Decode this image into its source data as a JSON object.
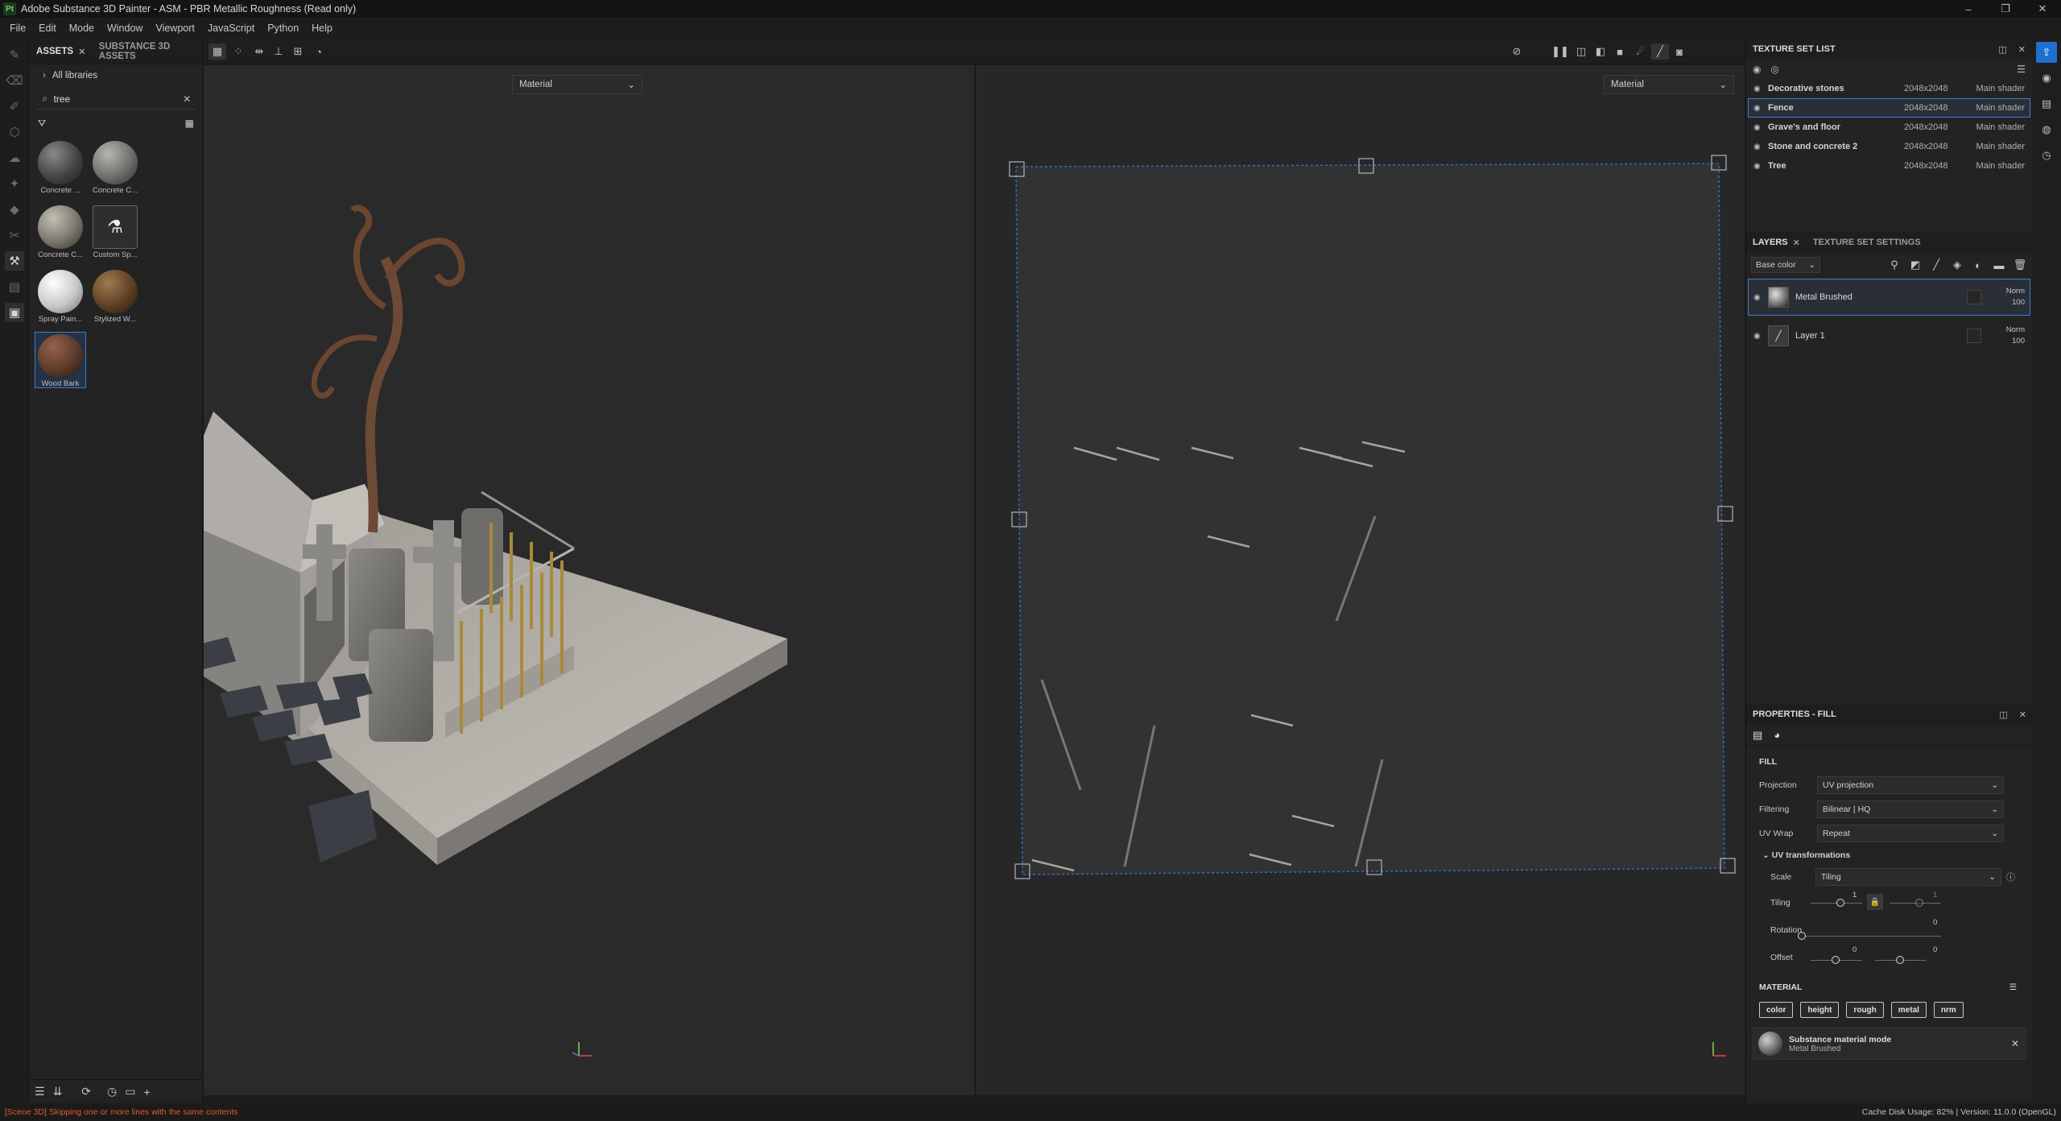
{
  "app": {
    "logo_text": "Pt",
    "title": "Adobe Substance 3D Painter - ASM - PBR Metallic Roughness (Read only)",
    "win_controls": [
      "–",
      "❐",
      "✕"
    ]
  },
  "menu": [
    "File",
    "Edit",
    "Mode",
    "Window",
    "Viewport",
    "JavaScript",
    "Python",
    "Help"
  ],
  "assets": {
    "tabs": [
      "ASSETS",
      "SUBSTANCE 3D ASSETS"
    ],
    "library": "All libraries",
    "search_value": "tree",
    "items": [
      {
        "label": "Concrete ...",
        "color": "#5c5c5c"
      },
      {
        "label": "Concrete C...",
        "color": "#8a8a88"
      },
      {
        "label": "Concrete C...",
        "color": "#9a9488"
      },
      {
        "label": "Custom Sp...",
        "color": "#3a3a3a"
      },
      {
        "label": "Spray Pain...",
        "color": "#d9d9d9"
      },
      {
        "label": "Stylized W...",
        "color": "#7a5a38"
      },
      {
        "label": "Wood Bark",
        "color": "#6a4636"
      }
    ]
  },
  "viewport": {
    "left_mode": "Material",
    "right_mode": "Material"
  },
  "texture_set_list": {
    "title": "TEXTURE SET LIST",
    "rows": [
      {
        "name": "Decorative stones",
        "res": "2048x2048",
        "shader": "Main shader"
      },
      {
        "name": "Fence",
        "res": "2048x2048",
        "shader": "Main shader"
      },
      {
        "name": "Grave's and floor",
        "res": "2048x2048",
        "shader": "Main shader"
      },
      {
        "name": "Stone and concrete 2",
        "res": "2048x2048",
        "shader": "Main shader"
      },
      {
        "name": "Tree",
        "res": "2048x2048",
        "shader": "Main shader"
      }
    ]
  },
  "layers": {
    "tabs": [
      "LAYERS",
      "TEXTURE SET SETTINGS"
    ],
    "channel": "Base color",
    "items": [
      {
        "name": "Metal Brushed",
        "blend": "Norm",
        "opacity": "100"
      },
      {
        "name": "Layer 1",
        "blend": "Norm",
        "opacity": "100"
      }
    ]
  },
  "properties": {
    "title": "PROPERTIES - FILL",
    "section": "FILL",
    "projection_label": "Projection",
    "projection_value": "UV projection",
    "filtering_label": "Filtering",
    "filtering_value": "Bilinear | HQ",
    "uvwrap_label": "UV Wrap",
    "uvwrap_value": "Repeat",
    "uv_trans_title": "UV transformations",
    "scale_label": "Scale",
    "scale_value": "Tiling",
    "tiling_label": "Tiling",
    "tiling_value": "1",
    "tiling_value2": "1",
    "rotation_label": "Rotation",
    "rotation_value": "0",
    "offset_label": "Offset",
    "offset_value_u": "0",
    "offset_value_v": "0",
    "material_title": "MATERIAL",
    "chips": [
      "color",
      "height",
      "rough",
      "metal",
      "nrm"
    ],
    "submat_title": "Substance material mode",
    "submat_name": "Metal Brushed"
  },
  "status": {
    "message": "[Scene 3D] Skipping one or more lines with the same contents",
    "right": "Cache Disk Usage:   82% | Version: 11.0.0 (OpenGL)"
  }
}
